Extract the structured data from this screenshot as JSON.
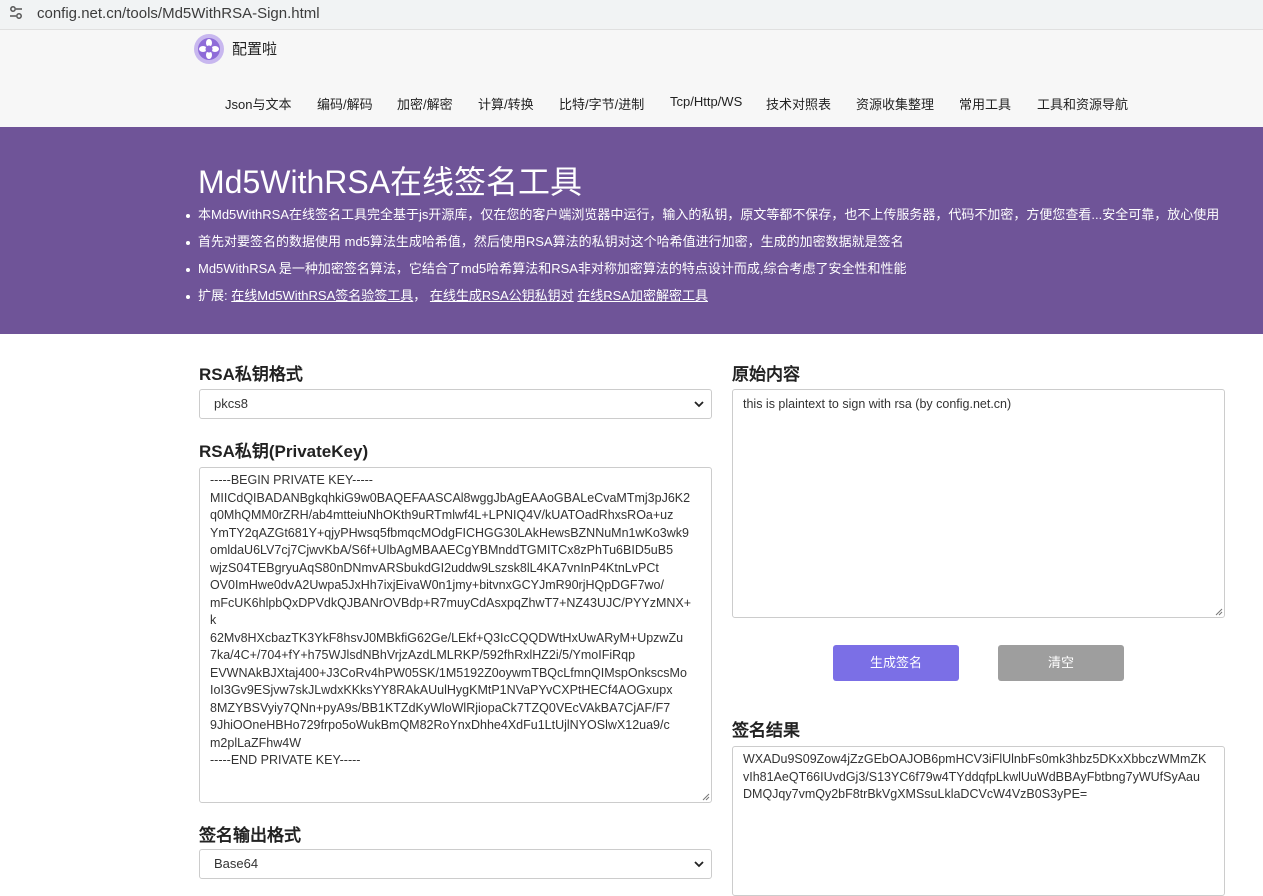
{
  "browser": {
    "url": "config.net.cn/tools/Md5WithRSA-Sign.html",
    "tune_icon": "tune-icon"
  },
  "site": {
    "logo_icon": "flower-logo-icon",
    "name": "配置啦",
    "nav": [
      "Json与文本",
      "编码/解码",
      "加密/解密",
      "计算/转换",
      "比特/字节/进制",
      "Tcp/Http/WS",
      "技术对照表",
      "资源收集整理",
      "常用工具",
      "工具和资源导航"
    ]
  },
  "hero": {
    "title": "Md5WithRSA在线签名工具",
    "bullets": [
      "本Md5WithRSA在线签名工具完全基于js开源库，仅在您的客户端浏览器中运行，输入的私钥，原文等都不保存，也不上传服务器，代码不加密，方便您查看...安全可靠，放心使用",
      "首先对要签名的数据使用 md5算法生成哈希值，然后使用RSA算法的私钥对这个哈希值进行加密，生成的加密数据就是签名",
      "Md5WithRSA 是一种加密签名算法，它结合了md5哈希算法和RSA非对称加密算法的特点设计而成,综合考虑了安全性和性能"
    ],
    "ext_prefix": "扩展:",
    "ext_links": [
      "在线Md5WithRSA签名验签工具",
      "在线生成RSA公钥私钥对",
      "在线RSA加密解密工具"
    ],
    "ext_sep": "，",
    "ext_space": " "
  },
  "form": {
    "key_format_label": "RSA私钥格式",
    "key_format_value": "pkcs8",
    "private_key_label": "RSA私钥(PrivateKey)",
    "private_key_lines": [
      "-----BEGIN PRIVATE KEY-----",
      "MIICdQIBADANBgkqhkiG9w0BAQEFAASCAl8wggJbAgEAAoGBALeCvaMTmj3pJ6K2",
      "q0MhQMM0rZRH/ab4mtteiuNhOKth9uRTmlwf4L+LPNIQ4V/kUATOadRhxsROa+uz",
      "YmTY2qAZGt681Y+qjyPHwsq5fbmqcMOdgFICHGG30LAkHewsBZNNuMn1wKo3wk9",
      "omldaU6LV7cj7CjwvKbA/S6f+UlbAgMBAAECgYBMnddTGMITCx8zPhTu6BID5uB5",
      "wjzS04TEBgryuAqS80nDNmvARSbukdGI2uddw9Lszsk8lL4KA7vnInP4KtnLvPCt",
      "OV0ImHwe0dvA2Uwpa5JxHh7ixjEivaW0n1jmy+bitvnxGCYJmR90rjHQpDGF7wo/",
      "mFcUK6hlpbQxDPVdkQJBANrOVBdp+R7muyCdAsxpqZhwT7+NZ43UJC/PYYzMNX+",
      "k",
      "62Mv8HXcbazTK3YkF8hsvJ0MBkfiG62Ge/LEkf+Q3IcCQQDWtHxUwARyM+UpzwZu",
      "7ka/4C+/704+fY+h75WJlsdNBhVrjzAzdLMLRKP/592fhRxlHZ2i/5/YmoIFiRqp",
      "EVWNAkBJXtaj400+J3CoRv4hPW05SK/1M5192Z0oywmTBQcLfmnQIMspOnkscsMo",
      "IoI3Gv9ESjvw7skJLwdxKKksYY8RAkAUulHygKMtP1NVaPYvCXPtHECf4AOGxupx",
      "8MZYBSVyiy7QNn+pyA9s/BB1KTZdKyWloWlRjiopaCk7TZQ0VEcVAkBA7CjAF/F7",
      "9JhiOOneHBHo729frpo5oWukBmQM82RoYnxDhhe4XdFu1LtUjlNYOSlwX12ua9/c",
      "m2plLaZFhw4W",
      "-----END PRIVATE KEY-----"
    ],
    "output_format_label": "签名输出格式",
    "output_format_value": "Base64",
    "original_label": "原始内容",
    "original_text": "this is plaintext to sign with rsa (by config.net.cn)",
    "generate_button": "生成签名",
    "clear_button": "清空",
    "result_label": "签名结果",
    "result_lines": [
      "WXADu9S09Zow4jZzGEbOAJOB6pmHCV3iFlUlnbFs0mk3hbz5DKxXbbczWMmZK",
      "vIh81AeQT66IUvdGj3/S13YC6f79w4TYddqfpLkwlUuWdBBAyFbtbng7yWUfSyAau",
      "DMQJqy7vmQy2bF8trBkVgXMSsuLklaDCVcW4VzB0S3yPE="
    ]
  },
  "colors": {
    "hero_bg": "#6f5498",
    "primary_button": "#7b6fe6",
    "gray_button": "#9e9e9e"
  }
}
